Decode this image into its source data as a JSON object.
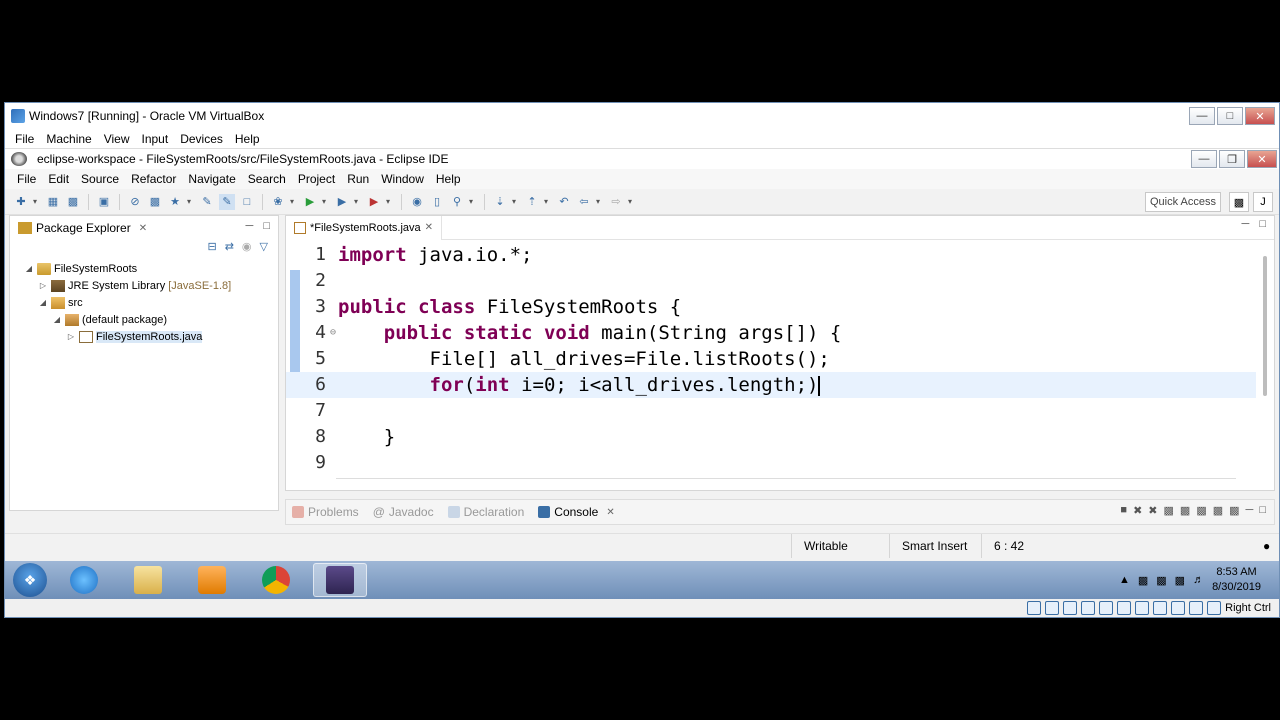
{
  "vbox": {
    "title": "Windows7 [Running] - Oracle VM VirtualBox",
    "menu": [
      "File",
      "Machine",
      "View",
      "Input",
      "Devices",
      "Help"
    ],
    "host_key": "Right Ctrl"
  },
  "eclipse": {
    "title": "eclipse-workspace - FileSystemRoots/src/FileSystemRoots.java - Eclipse IDE",
    "menu": [
      "File",
      "Edit",
      "Source",
      "Refactor",
      "Navigate",
      "Search",
      "Project",
      "Run",
      "Window",
      "Help"
    ],
    "quick_access": "Quick Access"
  },
  "package_explorer": {
    "tab_label": "Package Explorer",
    "tree": {
      "project": "FileSystemRoots",
      "jre": "JRE System Library",
      "jre_version": "[JavaSE-1.8]",
      "src": "src",
      "package": "(default package)",
      "file": "FileSystemRoots.java"
    }
  },
  "editor": {
    "tab_label": "*FileSystemRoots.java",
    "line_numbers": [
      "1",
      "2",
      "3",
      "4",
      "5",
      "6",
      "7",
      "8",
      "9"
    ],
    "lines": {
      "l1_kw": "import",
      "l1_rest": " java.io.*;",
      "l3_kw1": "public",
      "l3_kw2": "class",
      "l3_rest": " FileSystemRoots {",
      "l4_indent": "    ",
      "l4_kw1": "public",
      "l4_kw2": "static",
      "l4_kw3": "void",
      "l4_rest": " main(String args[]) {",
      "l5_text": "        File[] all_drives=File.listRoots();",
      "l6_indent": "        ",
      "l6_kw1": "for",
      "l6_mid": "(",
      "l6_kw2": "int",
      "l6_rest": " i=0; i<all_drives.length;)",
      "l8_text": "    }"
    }
  },
  "console": {
    "tabs": [
      "Problems",
      "Javadoc",
      "Declaration",
      "Console"
    ],
    "active_tab": "Console"
  },
  "status": {
    "writable": "Writable",
    "insert_mode": "Smart Insert",
    "position": "6 : 42"
  },
  "taskbar": {
    "time": "8:53 AM",
    "date": "8/30/2019"
  }
}
